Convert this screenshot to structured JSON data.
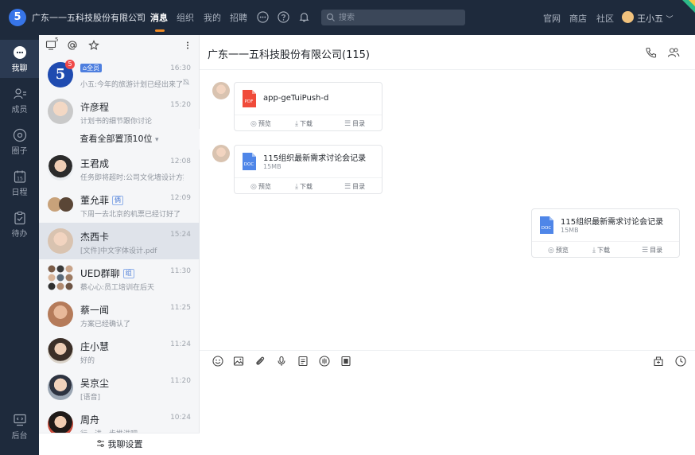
{
  "topbar": {
    "logo": "5",
    "org_name": "广东一一五科技股份有限公司",
    "org_caret": "﹀",
    "nav": [
      "消息",
      "组织",
      "我的",
      "招聘"
    ],
    "search_placeholder": "搜索",
    "links": [
      "官网",
      "商店",
      "社区"
    ],
    "user_name": "王小五",
    "user_caret": "﹀"
  },
  "rail": {
    "items": [
      {
        "label": "我聊"
      },
      {
        "label": "成员"
      },
      {
        "label": "圈子"
      },
      {
        "label": "日程",
        "icon_text": "15"
      },
      {
        "label": "待办"
      }
    ],
    "bottom": {
      "label": "后台"
    }
  },
  "list": {
    "toolbar_sup": "5",
    "conversations": [
      {
        "name": "",
        "tag": "全员",
        "time": "16:30",
        "msg": "小五:今年的旅游计划已经出来了",
        "badge": "5",
        "avatar_text": "5"
      },
      {
        "name": "许彦程",
        "time": "15:20",
        "msg": "计划书的细节跟你讨论"
      },
      {
        "name": "王君成",
        "time": "12:08",
        "msg": "任务即将超时:公司文化墙设计方案"
      },
      {
        "name": "董允菲",
        "tag": "俩",
        "time": "12:09",
        "msg": "下周一去北京的机票已经订好了"
      },
      {
        "name": "杰西卡",
        "time": "15:24",
        "msg": "[文件]中文字体设计.pdf"
      },
      {
        "name": "UED群聊",
        "tag": "组",
        "time": "11:30",
        "msg": "蔡心心:员工培训在后天"
      },
      {
        "name": "蔡一闻",
        "time": "11:25",
        "msg": "方案已经确认了"
      },
      {
        "name": "庄小慧",
        "time": "11:24",
        "msg": "好的"
      },
      {
        "name": "吴京尘",
        "time": "11:20",
        "msg": "[语音]"
      },
      {
        "name": "周舟",
        "time": "10:24",
        "msg": "行，进一步推进吧"
      }
    ],
    "show_top": "查看全部置顶10位",
    "show_top_caret": "▾",
    "footer": "我聊设置"
  },
  "chat": {
    "title": "广东一一五科技股份有限公司(115)",
    "messages": [
      {
        "file_name": "app-geTuiPush-d",
        "size": "",
        "type": "PDF"
      },
      {
        "file_name": "115组织最新需求讨论会记录",
        "size": "15MB",
        "type": "DOC"
      },
      {
        "file_name": "115组织最新需求讨论会记录",
        "size": "15MB",
        "type": "DOC"
      }
    ],
    "actions": {
      "preview": "预览",
      "download": "下载",
      "catalog": "目录"
    }
  },
  "colors": {
    "topbar_bg": "#1e2a3c",
    "accent": "#f08a24",
    "pdf_red": "#f04b3a",
    "doc_blue": "#4f86e8"
  }
}
